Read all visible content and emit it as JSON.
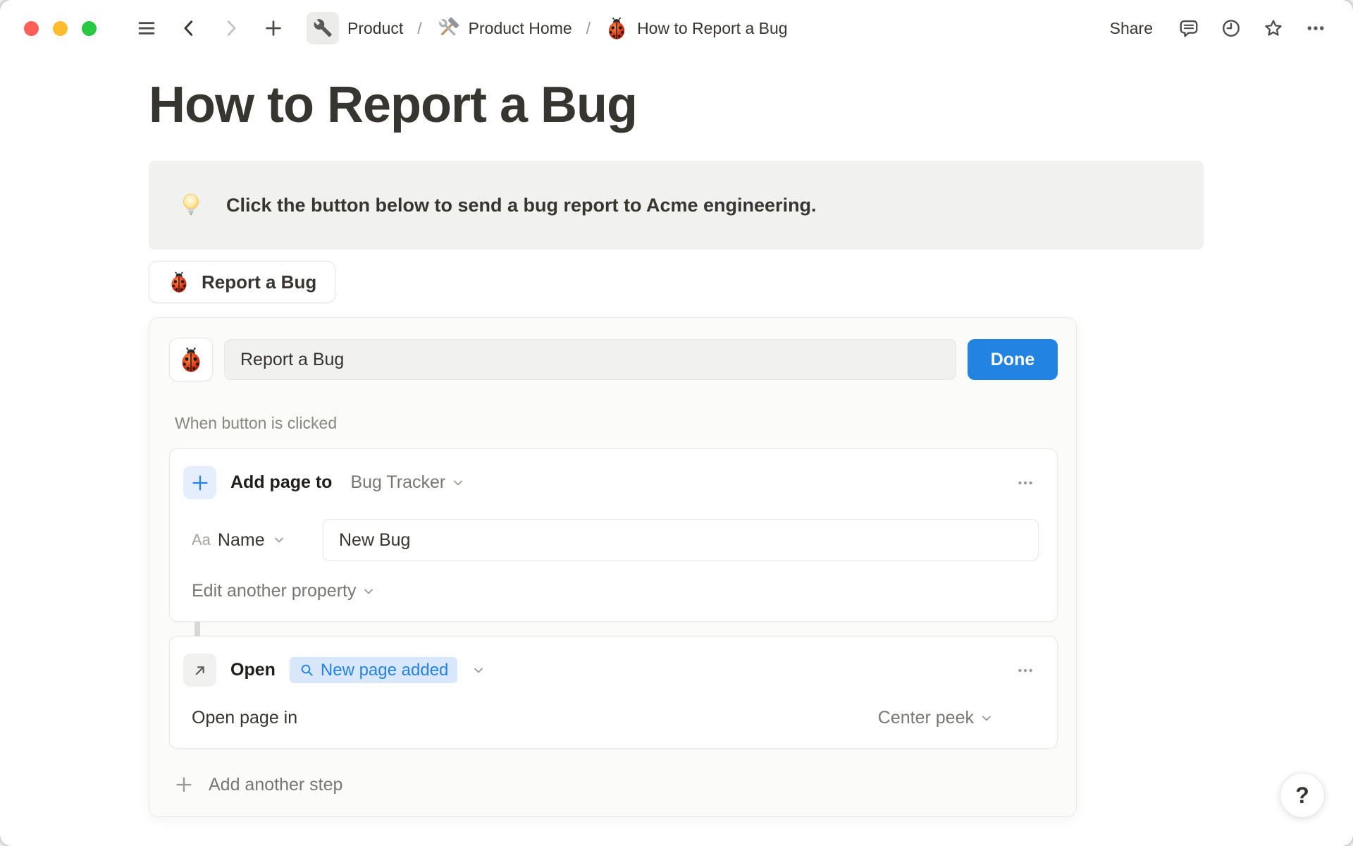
{
  "colors": {
    "accent_blue": "#2383e2",
    "chip_bg": "#d8e7fb",
    "callout_bg": "#f1f1ef",
    "traffic_close": "#ff5f57",
    "traffic_minimize": "#febc2e",
    "traffic_zoom": "#28c840"
  },
  "topbar": {
    "separator": "/",
    "breadcrumbs": [
      {
        "label": "Product",
        "icon": "wrench"
      },
      {
        "label": "Product Home",
        "icon": "hammer-and-wrench"
      },
      {
        "label": "How to Report a Bug",
        "icon": "lady-beetle"
      }
    ],
    "share_label": "Share"
  },
  "page": {
    "title": "How to Report a Bug",
    "callout": {
      "icon": "light-bulb",
      "text": "Click the button below to send a bug report to Acme engineering."
    },
    "bug_button": {
      "icon": "lady-beetle",
      "label": "Report a Bug"
    }
  },
  "editor": {
    "icon": "lady-beetle",
    "button_name_value": "Report a Bug",
    "done_label": "Done",
    "trigger_label": "When button is clicked",
    "step1": {
      "title": "Add page to",
      "target": "Bug Tracker",
      "property_type": "Aa",
      "property_name": "Name",
      "property_value": "New Bug",
      "edit_another_label": "Edit another property"
    },
    "step2": {
      "title": "Open",
      "chip_label": "New page added",
      "row_label": "Open page in",
      "row_value": "Center peek"
    },
    "add_step_label": "Add another step"
  },
  "help_button_label": "?"
}
